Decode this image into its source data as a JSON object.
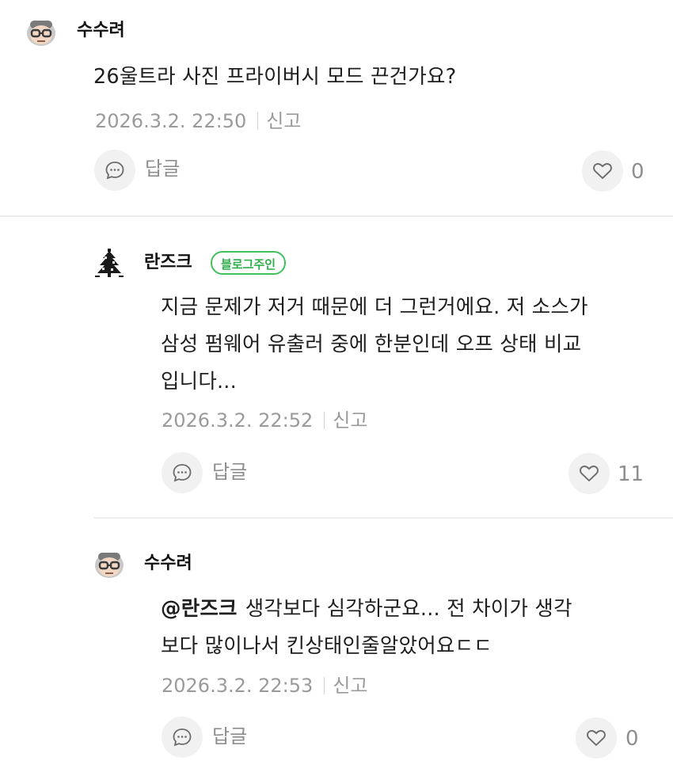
{
  "comments": [
    {
      "nickname": "수수려",
      "text": "26울트라 사진 프라이버시 모드 끈건가요?",
      "date": "2026.3.2. 22:50",
      "report": "신고",
      "reply": "답글",
      "likes": "0"
    },
    {
      "nickname": "란즈크",
      "badge": "블로그주인",
      "text_lines": [
        "지금 문제가 저거 때문에 더 그런거에요. 저 소스가",
        "삼성 펌웨어 유출러 중에 한분인데 오프 상태 비교",
        "입니다..."
      ],
      "date": "2026.3.2. 22:52",
      "report": "신고",
      "reply": "답글",
      "likes": "11"
    },
    {
      "nickname": "수수려",
      "mention": "@란즈크",
      "text_first": "생각보다 심각하군요... 전 차이가 생각",
      "text_second": "보다 많이나서 킨상태인줄알았어요ㄷㄷ",
      "date": "2026.3.2. 22:53",
      "report": "신고",
      "reply": "답글",
      "likes": "0"
    }
  ],
  "icons": {
    "avatar_1": "pixel-face-avatar",
    "avatar_2": "pixel-tree-avatar",
    "reply": "speech-bubble-icon",
    "like": "heart-icon"
  },
  "colors": {
    "badge_green": "#42c05d",
    "meta_gray": "#9a9a9a",
    "button_bg": "#f1f1f1"
  }
}
